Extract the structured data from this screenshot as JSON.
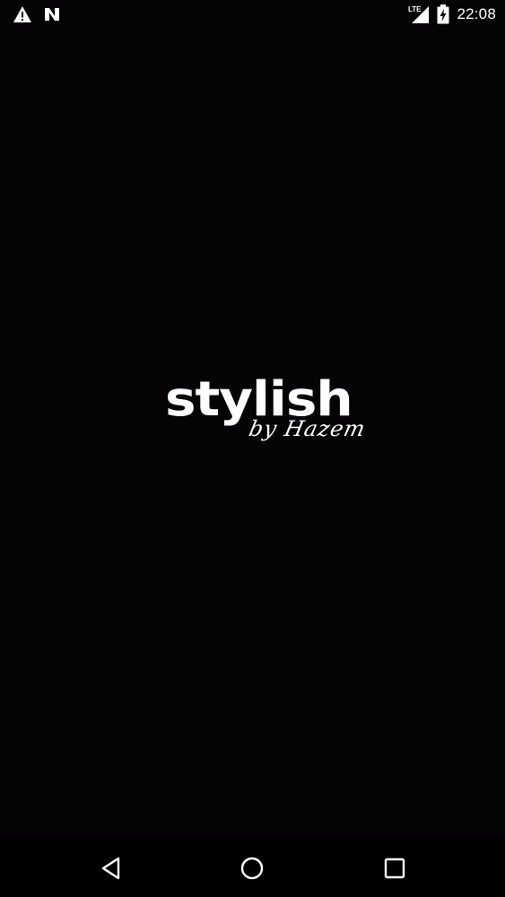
{
  "status_bar": {
    "time": "22:08",
    "network_type": "LTE",
    "left_icons": [
      "warning-icon",
      "n-icon"
    ],
    "right_icons": [
      "lte-signal-icon",
      "battery-charging-icon"
    ]
  },
  "splash": {
    "logo_word": "stylish",
    "logo_subtitle": "by Hazem",
    "background_color": "#050305",
    "logo_color": "#ffffff"
  },
  "nav_bar": {
    "buttons": [
      "back-icon",
      "home-icon",
      "recents-icon"
    ]
  }
}
